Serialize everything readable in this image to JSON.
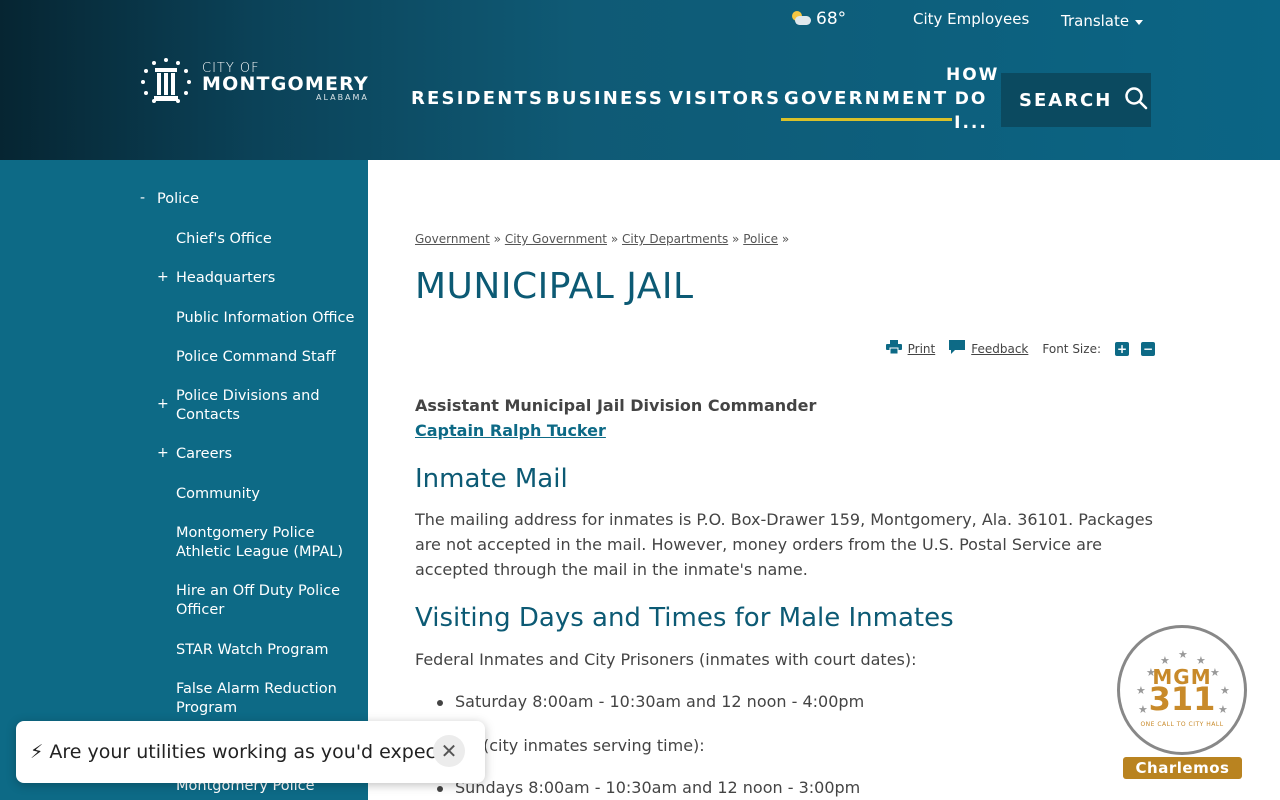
{
  "header": {
    "weather_temp": "68°",
    "weather_icon": "partly-cloudy-icon",
    "city_employees": "City Employees",
    "translate": "Translate",
    "logo": {
      "line1": "CITY OF",
      "line2": "MONTGOMERY",
      "line3": "ALABAMA"
    },
    "nav": [
      "RESIDENTS",
      "BUSINESS",
      "VISITORS",
      "GOVERNMENT"
    ],
    "active_nav": "GOVERNMENT",
    "how_do_i": [
      "HOW",
      "DO",
      "I..."
    ],
    "search": "SEARCH"
  },
  "sidebar": {
    "parent": {
      "toggle": "-",
      "label": "Police"
    },
    "items": [
      {
        "toggle": "",
        "label": "Chief's Office"
      },
      {
        "toggle": "+",
        "label": "Headquarters"
      },
      {
        "toggle": "",
        "label": "Public Information Office"
      },
      {
        "toggle": "",
        "label": "Police Command Staff"
      },
      {
        "toggle": "+",
        "label": "Police Divisions and Contacts"
      },
      {
        "toggle": "+",
        "label": "Careers"
      },
      {
        "toggle": "",
        "label": "Community"
      },
      {
        "toggle": "",
        "label": "Montgomery Police Athletic League (MPAL)"
      },
      {
        "toggle": "",
        "label": "Hire an Off Duty Police Officer"
      },
      {
        "toggle": "",
        "label": "STAR Watch Program"
      },
      {
        "toggle": "",
        "label": "False Alarm Reduction Program"
      },
      {
        "toggle": "",
        "label": "Montgomery Police"
      }
    ]
  },
  "breadcrumb": {
    "items": [
      "Government",
      "City Government",
      "City Departments",
      "Police"
    ],
    "separator": "»"
  },
  "page": {
    "title": "MUNICIPAL JAIL",
    "tools": {
      "print": "Print",
      "feedback": "Feedback",
      "font_size": "Font Size:",
      "increase": "+",
      "decrease": "−"
    },
    "commander_title": "Assistant Municipal Jail Division Commander",
    "commander_name": "Captain Ralph Tucker",
    "section1_title": "Inmate Mail",
    "section1_text": "The mailing address for inmates is P.O. Box-Drawer 159, Montgomery, Ala. 36101. Packages are not accepted in the mail. However, money orders from the U.S. Postal Service are accepted through the mail in the inmate's name.",
    "section2_title": "Visiting Days and Times for Male Inmates",
    "section2_intro": "Federal Inmates and City Prisoners (inmates with court dates):",
    "bullet1": "Saturday 8:00am - 10:30am and 12 noon - 4:00pm",
    "section2_intro2": "(city inmates serving time):",
    "bullet2": "Sundays 8:00am - 10:30am and 12 noon - 3:00pm"
  },
  "popup": {
    "icon": "lightning-icon",
    "text": "⚡ Are your utilities working as you'd expect?",
    "close": "✕"
  },
  "badge": {
    "brand": "MGM",
    "number": "311",
    "tagline": "ONE CALL TO CITY HALL",
    "name": "Charlemos"
  },
  "colors": {
    "header_dark": "#062532",
    "header_light": "#0b6585",
    "sidebar": "#0d6a86",
    "title": "#0c5a74",
    "accent_underline": "#d9c12a",
    "badge_gold": "#b98320"
  }
}
